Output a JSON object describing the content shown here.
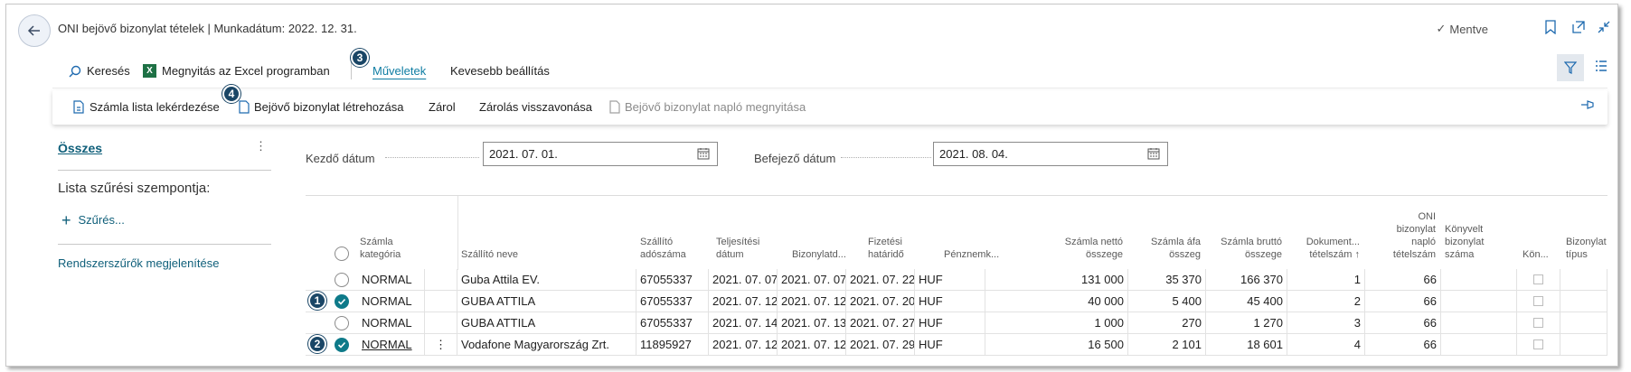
{
  "header": {
    "title": "ONI bejövő bizonylat tételek | Munkadátum: 2022. 12. 31.",
    "saved_label": "Mentve"
  },
  "actionbar": {
    "search": "Keresés",
    "excel": "Megnyitás az Excel programban",
    "actions_tab": "Műveletek",
    "fewer_options": "Kevesebb beállítás"
  },
  "submenu": {
    "invoice_query": "Számla lista lekérdezése",
    "create_incoming": "Bejövő bizonylat létrehozása",
    "close": "Zárol",
    "undo_close": "Zárolás visszavonása",
    "open_journal": "Bejövő bizonylat napló megnyitása"
  },
  "badges": [
    "1",
    "2",
    "3",
    "4"
  ],
  "left_pane": {
    "all": "Összes",
    "dots": "⋮",
    "filter_title": "Lista szűrési szempontja:",
    "add_filter": "Szűrés...",
    "system_filters": "Rendszerszűrők megjelenítése"
  },
  "filters": {
    "start_label": "Kezdő dátum",
    "start_value": "2021. 07. 01.",
    "end_label": "Befejező dátum",
    "end_value": "2021. 08. 04."
  },
  "columns": {
    "category": [
      "Számla",
      "kategória"
    ],
    "supplier": [
      "Szállító neve"
    ],
    "taxno": [
      "Szállító",
      "adószáma"
    ],
    "perf_date": [
      "Teljesítési",
      "dátum"
    ],
    "doc_date": [
      "Bizonylatd..."
    ],
    "due_date": [
      "Fizetési",
      "határidő"
    ],
    "currency": [
      "Pénznemk..."
    ],
    "net": [
      "Számla nettó",
      "összege"
    ],
    "vat": [
      "Számla áfa",
      "összeg"
    ],
    "gross": [
      "Számla bruttó",
      "összege"
    ],
    "docline": [
      "Dokument...",
      "tételszám ↑"
    ],
    "oni": [
      "ONI",
      "bizonylat",
      "napló",
      "tételszám"
    ],
    "booked": [
      "Könyvelt",
      "bizonylat",
      "száma"
    ],
    "kon": [
      "Kön..."
    ],
    "doctype": [
      "Bizonylat",
      "típus"
    ]
  },
  "rows": [
    {
      "selected": false,
      "category": "NORMAL",
      "supplier": "Guba Attila EV.",
      "taxno": "67055337",
      "perf_date": "2021. 07. 07.",
      "doc_date": "2021. 07. 07.",
      "due_date": "2021. 07. 22.",
      "currency": "HUF",
      "net": "131 000",
      "vat": "35 370",
      "gross": "166 370",
      "docline": "1",
      "oni": "66"
    },
    {
      "selected": true,
      "category": "NORMAL",
      "supplier": "GUBA ATTILA",
      "taxno": "67055337",
      "perf_date": "2021. 07. 12.",
      "doc_date": "2021. 07. 12.",
      "due_date": "2021. 07. 20.",
      "currency": "HUF",
      "net": "40 000",
      "vat": "5 400",
      "gross": "45 400",
      "docline": "2",
      "oni": "66"
    },
    {
      "selected": false,
      "category": "NORMAL",
      "supplier": "GUBA ATTILA",
      "taxno": "67055337",
      "perf_date": "2021. 07. 14.",
      "doc_date": "2021. 07. 13.",
      "due_date": "2021. 07. 27.",
      "currency": "HUF",
      "net": "1 000",
      "vat": "270",
      "gross": "1 270",
      "docline": "3",
      "oni": "66"
    },
    {
      "selected": true,
      "category": "NORMAL",
      "supplier": "Vodafone Magyarország Zrt.",
      "taxno": "11895927",
      "perf_date": "2021. 07. 12.",
      "doc_date": "2021. 07. 12.",
      "due_date": "2021. 07. 29.",
      "currency": "HUF",
      "net": "16 500",
      "vat": "2 101",
      "gross": "18 601",
      "docline": "4",
      "oni": "66"
    }
  ],
  "colors": {
    "accent": "#0e7a89",
    "link": "#0f5f7a",
    "badge": "#1a4666"
  }
}
